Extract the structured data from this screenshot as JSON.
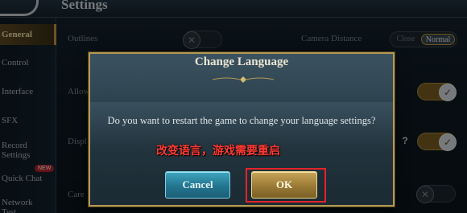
{
  "header": {
    "title": "Settings"
  },
  "sidebar": {
    "items": [
      {
        "label": "General"
      },
      {
        "label": "Control"
      },
      {
        "label": "Interface"
      },
      {
        "label": "SFX"
      },
      {
        "label": "Record Settings"
      },
      {
        "label": "Quick Chat"
      },
      {
        "label": "Network Test"
      }
    ],
    "new_badge": "NEW"
  },
  "settings": {
    "outlines_label": "Outlines",
    "camera_distance_label": "Camera Distance",
    "camera_options": [
      "Close",
      "Normal"
    ],
    "camera_selected": "Normal",
    "row2_label_partial": "Allow",
    "row3_label_partial": "Displ",
    "row4_label_partial": "Care",
    "help_symbol": "?"
  },
  "dialog": {
    "title": "Change Language",
    "message": "Do you want to restart the game to change your language settings?",
    "annotation": "改变语言，游戏需要重启",
    "cancel_label": "Cancel",
    "ok_label": "OK"
  },
  "colors": {
    "accent_gold": "#b59953",
    "highlight_red": "#e3242a",
    "cancel_teal": "#23758f"
  }
}
